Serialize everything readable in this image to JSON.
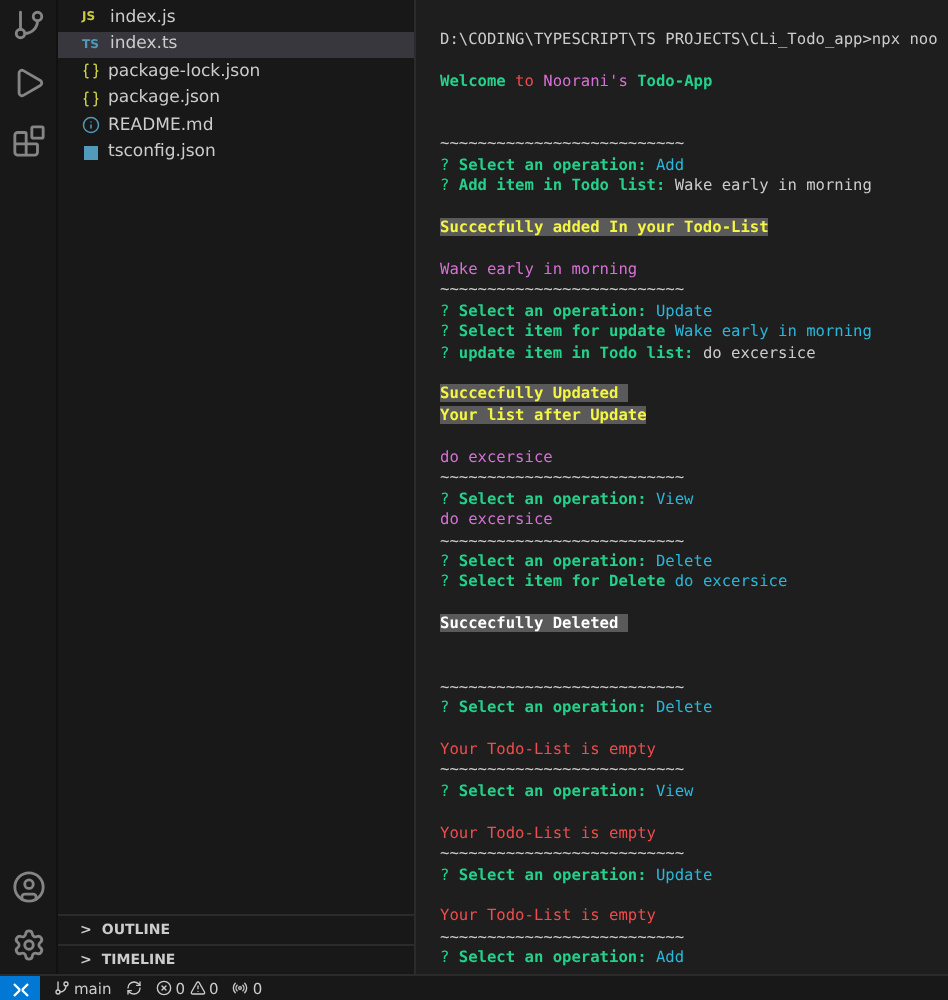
{
  "files": [
    {
      "name": "index.js",
      "kind": "js",
      "badge": "JS",
      "selected": false
    },
    {
      "name": "index.ts",
      "kind": "ts",
      "badge": "TS",
      "selected": true
    },
    {
      "name": "package-lock.json",
      "kind": "json",
      "selected": false
    },
    {
      "name": "package.json",
      "kind": "json",
      "selected": false
    },
    {
      "name": "README.md",
      "kind": "info",
      "selected": false
    },
    {
      "name": "tsconfig.json",
      "kind": "tsconfig",
      "selected": false
    }
  ],
  "panels": [
    {
      "chevron": ">",
      "label": "OUTLINE"
    },
    {
      "chevron": ">",
      "label": "TIMELINE"
    }
  ],
  "terminal": [
    {
      "kind": "text",
      "segments": [
        {
          "text": "D:\\CODING\\TYPESCRIPT\\TS PROJECTS\\CLi_Todo_app>npx noo",
          "color": "#cccccc"
        }
      ]
    },
    {
      "kind": "blank"
    },
    {
      "kind": "text",
      "segments": [
        {
          "text": "Welcome",
          "color": "#23d18b",
          "bold": true
        },
        {
          "text": " to",
          "color": "#f14c4c"
        },
        {
          "text": " Noorani's",
          "color": "#d670d6"
        },
        {
          "text": " Todo-App",
          "color": "#23d18b",
          "bold": true
        }
      ]
    },
    {
      "kind": "blank"
    },
    {
      "kind": "blank"
    },
    {
      "kind": "text",
      "segments": [
        {
          "text": "~~~~~~~~~~~~~~~~~~~~~~~~~~",
          "color": "#cccccc"
        }
      ]
    },
    {
      "kind": "text",
      "segments": [
        {
          "text": "?",
          "color": "#23d18b"
        },
        {
          "text": " Select an operation:",
          "color": "#23d18b",
          "bold": true
        },
        {
          "text": " Add",
          "color": "#29b8db"
        }
      ]
    },
    {
      "kind": "text",
      "segments": [
        {
          "text": "?",
          "color": "#23d18b"
        },
        {
          "text": " Add item in Todo list:",
          "color": "#23d18b",
          "bold": true
        },
        {
          "text": " Wake early in morning",
          "color": "#cccccc"
        }
      ]
    },
    {
      "kind": "blank"
    },
    {
      "kind": "text",
      "segments": [
        {
          "text": "Succecfully added In your Todo-List",
          "kind": "yellow-highlight"
        }
      ]
    },
    {
      "kind": "blank"
    },
    {
      "kind": "text",
      "segments": [
        {
          "text": "Wake early in morning",
          "color": "#d670d6"
        }
      ]
    },
    {
      "kind": "text",
      "segments": [
        {
          "text": "~~~~~~~~~~~~~~~~~~~~~~~~~~",
          "color": "#cccccc"
        }
      ]
    },
    {
      "kind": "text",
      "segments": [
        {
          "text": "?",
          "color": "#23d18b"
        },
        {
          "text": " Select an operation:",
          "color": "#23d18b",
          "bold": true
        },
        {
          "text": " Update",
          "color": "#29b8db"
        }
      ]
    },
    {
      "kind": "text",
      "segments": [
        {
          "text": "?",
          "color": "#23d18b"
        },
        {
          "text": " Select item for update",
          "color": "#23d18b",
          "bold": true
        },
        {
          "text": " Wake early in morning",
          "color": "#29b8db"
        }
      ]
    },
    {
      "kind": "text",
      "segments": [
        {
          "text": "?",
          "color": "#23d18b"
        },
        {
          "text": " update item in Todo list:",
          "color": "#23d18b",
          "bold": true
        },
        {
          "text": " do excersice",
          "color": "#cccccc"
        }
      ]
    },
    {
      "kind": "blank"
    },
    {
      "kind": "text",
      "segments": [
        {
          "text": "Succecfully Updated ",
          "kind": "yellow-highlight"
        }
      ]
    },
    {
      "kind": "text",
      "segments": [
        {
          "text": "Your list after Update",
          "kind": "yellow-highlight"
        }
      ]
    },
    {
      "kind": "blank"
    },
    {
      "kind": "text",
      "segments": [
        {
          "text": "do excersice",
          "color": "#d670d6"
        }
      ]
    },
    {
      "kind": "text",
      "segments": [
        {
          "text": "~~~~~~~~~~~~~~~~~~~~~~~~~~",
          "color": "#cccccc"
        }
      ]
    },
    {
      "kind": "text",
      "segments": [
        {
          "text": "?",
          "color": "#23d18b"
        },
        {
          "text": " Select an operation:",
          "color": "#23d18b",
          "bold": true
        },
        {
          "text": " View",
          "color": "#29b8db"
        }
      ]
    },
    {
      "kind": "text",
      "segments": [
        {
          "text": "do excersice",
          "color": "#d670d6"
        }
      ]
    },
    {
      "kind": "text",
      "segments": [
        {
          "text": "~~~~~~~~~~~~~~~~~~~~~~~~~~",
          "color": "#cccccc"
        }
      ]
    },
    {
      "kind": "text",
      "segments": [
        {
          "text": "?",
          "color": "#23d18b"
        },
        {
          "text": " Select an operation:",
          "color": "#23d18b",
          "bold": true
        },
        {
          "text": " Delete",
          "color": "#29b8db"
        }
      ]
    },
    {
      "kind": "text",
      "segments": [
        {
          "text": "?",
          "color": "#23d18b"
        },
        {
          "text": " Select item for Delete",
          "color": "#23d18b",
          "bold": true
        },
        {
          "text": " do excersice",
          "color": "#29b8db"
        }
      ]
    },
    {
      "kind": "blank"
    },
    {
      "kind": "text",
      "segments": [
        {
          "text": "Succecfully Deleted ",
          "kind": "white-highlight"
        }
      ]
    },
    {
      "kind": "blank"
    },
    {
      "kind": "blank"
    },
    {
      "kind": "text",
      "segments": [
        {
          "text": "~~~~~~~~~~~~~~~~~~~~~~~~~~",
          "color": "#cccccc"
        }
      ]
    },
    {
      "kind": "text",
      "segments": [
        {
          "text": "?",
          "color": "#23d18b"
        },
        {
          "text": " Select an operation:",
          "color": "#23d18b",
          "bold": true
        },
        {
          "text": " Delete",
          "color": "#29b8db"
        }
      ]
    },
    {
      "kind": "blank"
    },
    {
      "kind": "text",
      "segments": [
        {
          "text": "Your Todo-List is empty",
          "color": "#f14c4c"
        }
      ]
    },
    {
      "kind": "text",
      "segments": [
        {
          "text": "~~~~~~~~~~~~~~~~~~~~~~~~~~",
          "color": "#cccccc"
        }
      ]
    },
    {
      "kind": "text",
      "segments": [
        {
          "text": "?",
          "color": "#23d18b"
        },
        {
          "text": " Select an operation:",
          "color": "#23d18b",
          "bold": true
        },
        {
          "text": " View",
          "color": "#29b8db"
        }
      ]
    },
    {
      "kind": "blank"
    },
    {
      "kind": "text",
      "segments": [
        {
          "text": "Your Todo-List is empty",
          "color": "#f14c4c"
        }
      ]
    },
    {
      "kind": "text",
      "segments": [
        {
          "text": "~~~~~~~~~~~~~~~~~~~~~~~~~~",
          "color": "#cccccc"
        }
      ]
    },
    {
      "kind": "text",
      "segments": [
        {
          "text": "?",
          "color": "#23d18b"
        },
        {
          "text": " Select an operation:",
          "color": "#23d18b",
          "bold": true
        },
        {
          "text": " Update",
          "color": "#29b8db"
        }
      ]
    },
    {
      "kind": "blank"
    },
    {
      "kind": "text",
      "segments": [
        {
          "text": "Your Todo-List is empty",
          "color": "#f14c4c"
        }
      ]
    },
    {
      "kind": "text",
      "segments": [
        {
          "text": "~~~~~~~~~~~~~~~~~~~~~~~~~~",
          "color": "#cccccc"
        }
      ]
    },
    {
      "kind": "text",
      "segments": [
        {
          "text": "?",
          "color": "#23d18b"
        },
        {
          "text": " Select an operation:",
          "color": "#23d18b",
          "bold": true
        },
        {
          "text": " Add",
          "color": "#29b8db"
        }
      ]
    }
  ],
  "status_bar": {
    "branch": "main",
    "errors": "0",
    "warnings": "0",
    "ports": "0"
  }
}
